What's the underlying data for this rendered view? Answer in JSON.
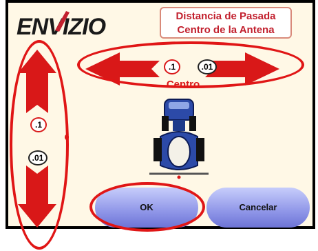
{
  "app": {
    "logo_text": "ENVIZIO"
  },
  "title": {
    "line1": "Distancia de Pasada",
    "line2": "Centro de la Antena"
  },
  "horizontal": {
    "step_coarse": ".1",
    "step_fine": ".01",
    "label": "Centro"
  },
  "vertical": {
    "step_coarse": ".1",
    "step_fine": ".01"
  },
  "buttons": {
    "ok_label": "OK",
    "cancel_label": "Cancelar"
  },
  "colors": {
    "accent_red": "#d91818",
    "button_blue": "#8f96e8",
    "panel_bg": "#fff8e6"
  },
  "icons": [
    "left-arrow-icon",
    "right-arrow-icon",
    "up-arrow-icon",
    "down-arrow-icon",
    "tractor-icon"
  ]
}
